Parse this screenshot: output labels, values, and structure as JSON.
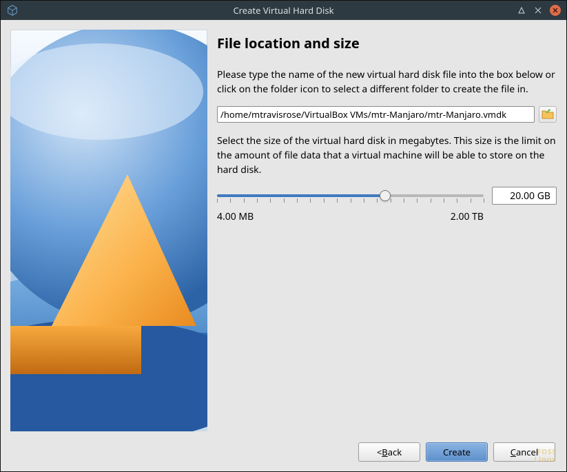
{
  "window": {
    "title": "Create Virtual Hard Disk"
  },
  "page": {
    "heading": "File location and size",
    "help1": "Please type the name of the new virtual hard disk file into the box below or click on the folder icon to select a different folder to create the file in.",
    "help2": "Select the size of the virtual hard disk in megabytes. This size is the limit on the amount of file data that a virtual machine will be able to store on the hard disk."
  },
  "fields": {
    "path_value": "/home/mtravisrose/VirtualBox VMs/mtr-Manjaro/mtr-Manjaro.vmdk",
    "size_value": "20.00 GB",
    "slider_min_label": "4.00 MB",
    "slider_max_label": "2.00 TB",
    "slider_percent": 63
  },
  "buttons": {
    "back": "< Back",
    "back_ul_char": "B",
    "create": "Create",
    "cancel": "Cancel",
    "cancel_ul_char": "C"
  },
  "watermark": {
    "line1": "FOSS",
    "line2": "Linux"
  }
}
